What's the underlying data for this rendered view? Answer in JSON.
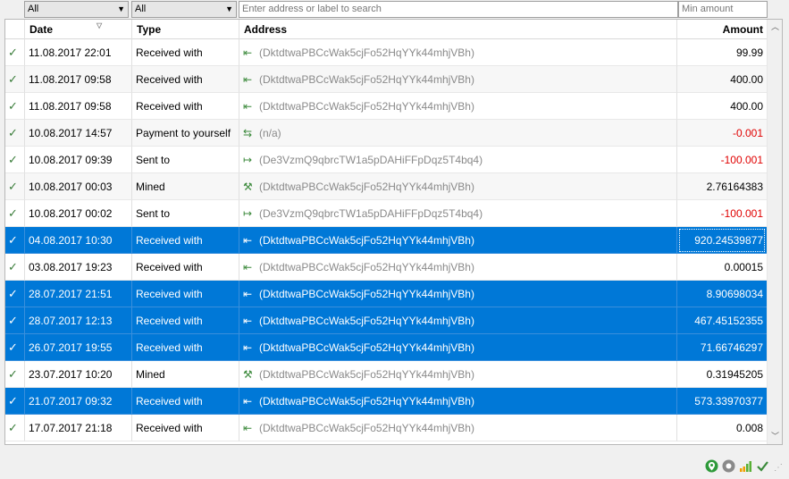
{
  "filters": {
    "date_filter": "All",
    "type_filter": "All",
    "search_placeholder": "Enter address or label to search",
    "min_amount_placeholder": "Min amount"
  },
  "columns": {
    "date": "Date",
    "type": "Type",
    "address": "Address",
    "amount": "Amount"
  },
  "rows": [
    {
      "date": "11.08.2017 22:01",
      "type": "Received with",
      "address": "(DktdtwaPBCcWak5cjFo52HqYYk44mhjVBh)",
      "amount": "99.99",
      "icon": "receive"
    },
    {
      "date": "11.08.2017 09:58",
      "type": "Received with",
      "address": "(DktdtwaPBCcWak5cjFo52HqYYk44mhjVBh)",
      "amount": "400.00",
      "icon": "receive"
    },
    {
      "date": "11.08.2017 09:58",
      "type": "Received with",
      "address": "(DktdtwaPBCcWak5cjFo52HqYYk44mhjVBh)",
      "amount": "400.00",
      "icon": "receive"
    },
    {
      "date": "10.08.2017 14:57",
      "type": "Payment to yourself",
      "address": "(n/a)",
      "amount": "-0.001",
      "icon": "self"
    },
    {
      "date": "10.08.2017 09:39",
      "type": "Sent to",
      "address": "(De3VzmQ9qbrcTW1a5pDAHiFFpDqz5T4bq4)",
      "amount": "-100.001",
      "icon": "send"
    },
    {
      "date": "10.08.2017 00:03",
      "type": "Mined",
      "address": "(DktdtwaPBCcWak5cjFo52HqYYk44mhjVBh)",
      "amount": "2.76164383",
      "icon": "mined"
    },
    {
      "date": "10.08.2017 00:02",
      "type": "Sent to",
      "address": "(De3VzmQ9qbrcTW1a5pDAHiFFpDqz5T4bq4)",
      "amount": "-100.001",
      "icon": "send"
    },
    {
      "date": "04.08.2017 10:30",
      "type": "Received with",
      "address": "(DktdtwaPBCcWak5cjFo52HqYYk44mhjVBh)",
      "amount": "920.24539877",
      "icon": "receive"
    },
    {
      "date": "03.08.2017 19:23",
      "type": "Received with",
      "address": "(DktdtwaPBCcWak5cjFo52HqYYk44mhjVBh)",
      "amount": "0.00015",
      "icon": "receive"
    },
    {
      "date": "28.07.2017 21:51",
      "type": "Received with",
      "address": "(DktdtwaPBCcWak5cjFo52HqYYk44mhjVBh)",
      "amount": "8.90698034",
      "icon": "receive"
    },
    {
      "date": "28.07.2017 12:13",
      "type": "Received with",
      "address": "(DktdtwaPBCcWak5cjFo52HqYYk44mhjVBh)",
      "amount": "467.45152355",
      "icon": "receive"
    },
    {
      "date": "26.07.2017 19:55",
      "type": "Received with",
      "address": "(DktdtwaPBCcWak5cjFo52HqYYk44mhjVBh)",
      "amount": "71.66746297",
      "icon": "receive"
    },
    {
      "date": "23.07.2017 10:20",
      "type": "Mined",
      "address": "(DktdtwaPBCcWak5cjFo52HqYYk44mhjVBh)",
      "amount": "0.31945205",
      "icon": "mined"
    },
    {
      "date": "21.07.2017 09:32",
      "type": "Received with",
      "address": "(DktdtwaPBCcWak5cjFo52HqYYk44mhjVBh)",
      "amount": "573.33970377",
      "icon": "receive"
    },
    {
      "date": "17.07.2017 21:18",
      "type": "Received with",
      "address": "(DktdtwaPBCcWak5cjFo52HqYYk44mhjVBh)",
      "amount": "0.008",
      "icon": "receive"
    }
  ],
  "selected_rows": [
    7,
    9,
    10,
    11,
    13
  ],
  "focused_row": 7,
  "status_icons": [
    "network-icon",
    "tor-icon",
    "connection-signal-icon",
    "synced-check-icon"
  ],
  "colors": {
    "selection": "#0078d7",
    "negative": "#e00000",
    "positive_icon": "#3c8a3c"
  }
}
